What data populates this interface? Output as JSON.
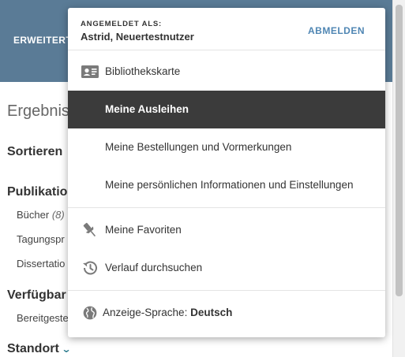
{
  "background": {
    "topbar_link": "ERWEITERT",
    "results_heading": "Ergebnis",
    "sort_heading": "Sortieren",
    "publication_heading": "Publikatio",
    "publication_items": [
      {
        "label": "Bücher",
        "count": "(8)"
      },
      {
        "label": "Tagungspr",
        "count": ""
      },
      {
        "label": "Dissertatio",
        "count": ""
      }
    ],
    "availability_heading": "Verfügbar",
    "availability_items": [
      "Bereitgeste"
    ],
    "location_heading": "Standort"
  },
  "account_menu": {
    "signed_in_label": "ANGEMELDET ALS:",
    "user_name": "Astrid, Neuertestnutzer",
    "logout_label": "ABMELDEN",
    "items": [
      {
        "label": "Bibliothekskarte",
        "icon": "library-card-icon",
        "active": false
      },
      {
        "label": "Meine Ausleihen",
        "icon": "",
        "active": true
      },
      {
        "label": "Meine Bestellungen und Vormerkungen",
        "icon": "",
        "active": false
      },
      {
        "label": "Meine persönlichen Informationen und Einstellungen",
        "icon": "",
        "active": false
      }
    ],
    "secondary_items": [
      {
        "label": "Meine Favoriten",
        "icon": "pin-icon"
      },
      {
        "label": "Verlauf durchsuchen",
        "icon": "history-icon"
      }
    ],
    "language_label": "Anzeige-Sprache: ",
    "language_value": "Deutsch"
  },
  "colors": {
    "topbar": "#5a7b96",
    "active_item": "#3b3b3b",
    "link_accent": "#4f86b3"
  }
}
